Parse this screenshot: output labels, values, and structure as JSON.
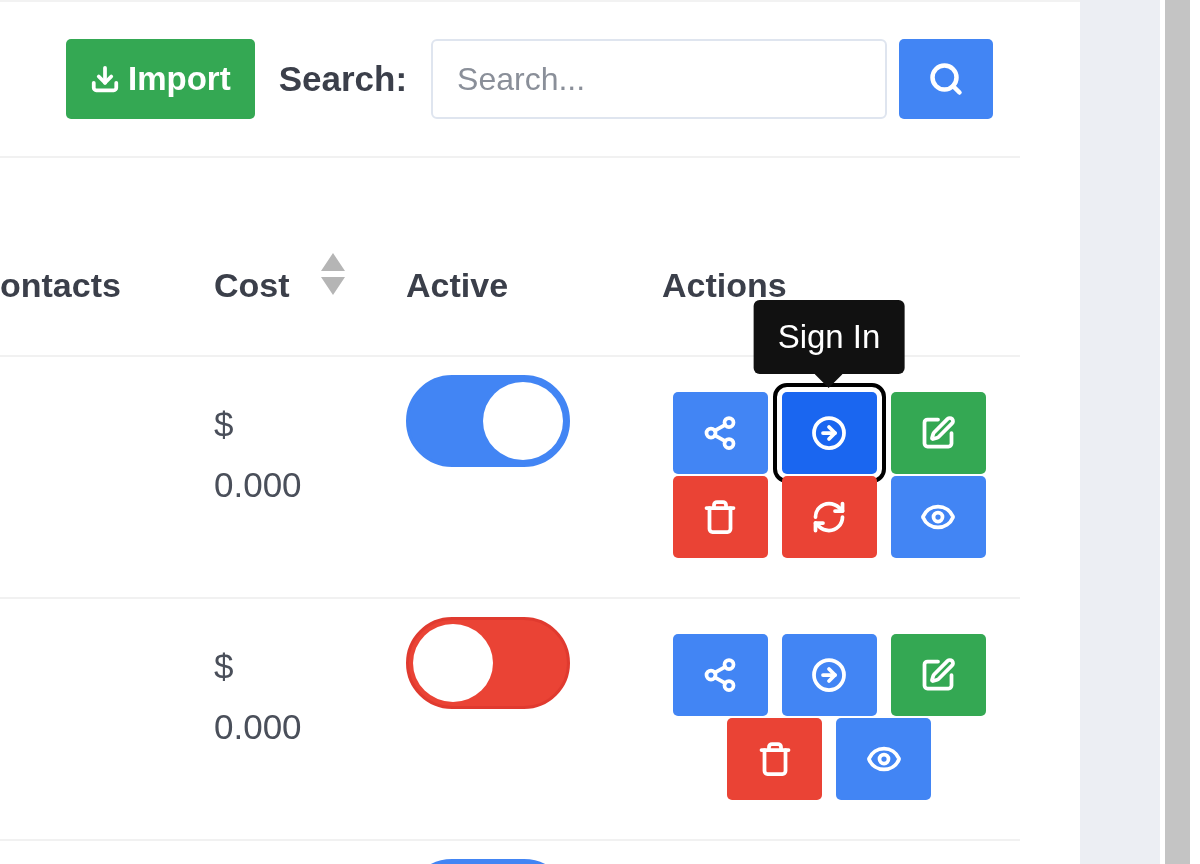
{
  "toolbar": {
    "import_button": "Import",
    "search_label": "Search:",
    "search": {
      "placeholder": "Search..."
    }
  },
  "table": {
    "columns": [
      {
        "label": "ontacts",
        "sortable": false
      },
      {
        "label": "Cost",
        "sortable": true
      },
      {
        "label": "Active",
        "sortable": false
      },
      {
        "label": "Actions",
        "sortable": false
      }
    ],
    "rows": [
      {
        "cost": "$ 0.000",
        "active": true,
        "actions": [
          {
            "kind": "share",
            "focused": false
          },
          {
            "kind": "sign-in",
            "focused": true,
            "tooltip": "Sign In"
          },
          {
            "kind": "edit",
            "focused": false
          },
          {
            "kind": "delete",
            "focused": false
          },
          {
            "kind": "reset",
            "focused": false
          },
          {
            "kind": "view",
            "focused": false
          }
        ]
      },
      {
        "cost": "$ 0.000",
        "active": false,
        "actions": [
          {
            "kind": "share",
            "focused": false
          },
          {
            "kind": "sign-in",
            "focused": false
          },
          {
            "kind": "edit",
            "focused": false
          },
          {
            "kind": "delete",
            "focused": false
          },
          {
            "kind": "view",
            "focused": false
          }
        ]
      },
      {
        "active": true,
        "actions": []
      }
    ]
  }
}
